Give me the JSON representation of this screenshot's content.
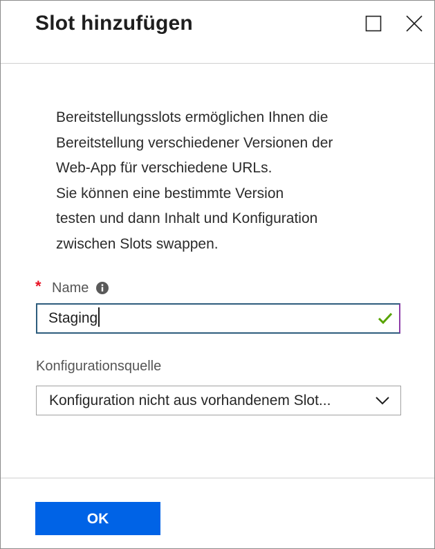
{
  "header": {
    "title": "Slot hinzufügen",
    "maximize_icon": "maximize-icon",
    "close_icon": "close-icon"
  },
  "description": {
    "lines": [
      "Bereitstellungsslots ermöglichen Ihnen die",
      "Bereitstellung verschiedener Versionen der",
      "Web-App für verschiedene URLs.",
      "Sie können eine bestimmte Version",
      "testen und dann Inhalt und Konfiguration",
      "zwischen Slots swappen."
    ]
  },
  "name_field": {
    "required_marker": "*",
    "label": "Name",
    "info_icon": "info-icon",
    "value": "Staging",
    "validation_icon": "checkmark-icon"
  },
  "config_source": {
    "label": "Konfigurationsquelle",
    "selected": "Konfiguration nicht aus vorhandenem Slot...",
    "dropdown_icon": "chevron-down-icon"
  },
  "footer": {
    "ok_label": "OK"
  },
  "colors": {
    "accent": "#0063e6",
    "required": "#e81123",
    "valid": "#57a300",
    "input_border": "#2d5c7c"
  }
}
